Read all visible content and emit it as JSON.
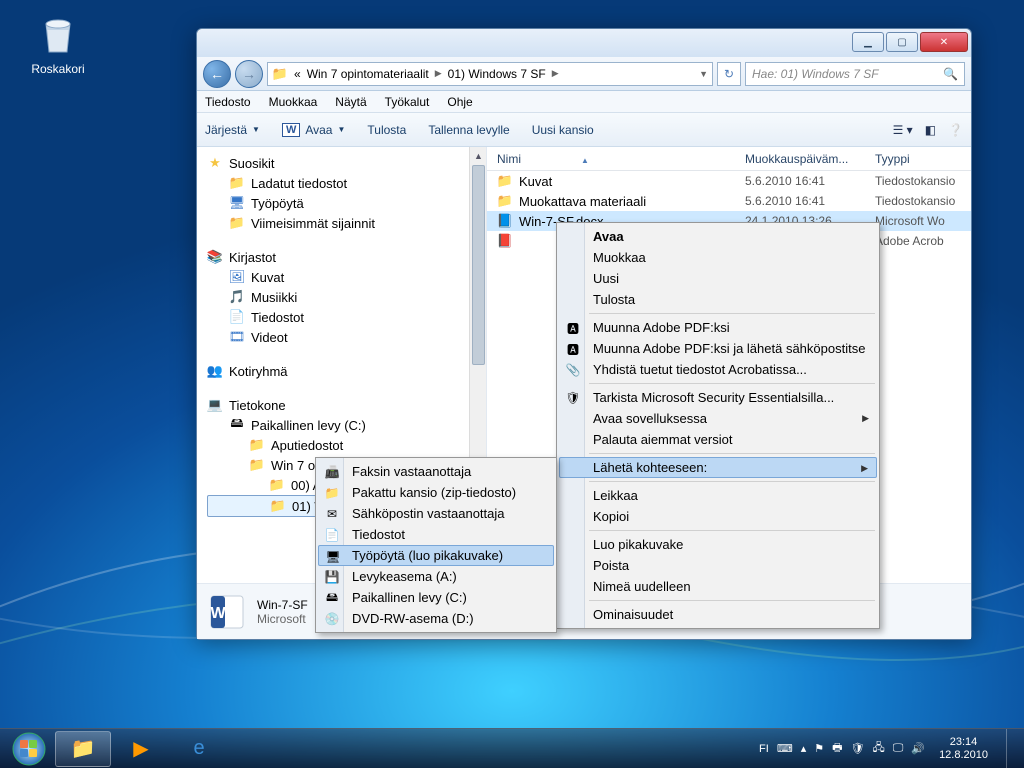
{
  "desktop": {
    "recycle_bin": "Roskakori"
  },
  "window": {
    "controls": {
      "min": "▁",
      "max": "▢",
      "close": "✕"
    },
    "breadcrumb": {
      "prefix": "«",
      "seg1": "Win 7 opintomateriaalit",
      "seg2": "01) Windows 7 SF"
    },
    "search_placeholder": "Hae: 01) Windows 7 SF",
    "menus": [
      "Tiedosto",
      "Muokkaa",
      "Näytä",
      "Työkalut",
      "Ohje"
    ],
    "toolbar": {
      "organize": "Järjestä",
      "open": "Avaa",
      "print": "Tulosta",
      "save": "Tallenna levylle",
      "newfolder": "Uusi kansio"
    }
  },
  "nav": {
    "favorites": "Suosikit",
    "fav_items": [
      "Ladatut tiedostot",
      "Työpöytä",
      "Viimeisimmät sijainnit"
    ],
    "libraries": "Kirjastot",
    "lib_items": [
      "Kuvat",
      "Musiikki",
      "Tiedostot",
      "Videot"
    ],
    "homegroup": "Kotiryhmä",
    "computer": "Tietokone",
    "local": "Paikallinen levy (C:)",
    "aputied": "Aputiedostot",
    "win7mat": "Win 7 opintomateriaalit",
    "f00": "00) Aputiedostot",
    "f01": "01) Windows 7 SF"
  },
  "columns": {
    "name": "Nimi",
    "modified": "Muokkauspäiväm...",
    "type": "Tyyppi"
  },
  "files": [
    {
      "name": "Kuvat",
      "date": "5.6.2010 16:41",
      "type": "Tiedostokansio",
      "icon": "folder"
    },
    {
      "name": "Muokattava materiaali",
      "date": "5.6.2010 16:41",
      "type": "Tiedostokansio",
      "icon": "folder"
    },
    {
      "name": "Win-7-SF.docx",
      "date": "24.1.2010 13:26",
      "type": "Microsoft Wo",
      "icon": "word",
      "sel": true
    },
    {
      "name": "",
      "date": "",
      "type": "Adobe Acrob",
      "icon": "pdf"
    }
  ],
  "details": {
    "title": "Win-7-SF",
    "sub": "Microsoft"
  },
  "ctx_main": [
    {
      "t": "Avaa",
      "bold": true
    },
    {
      "t": "Muokkaa"
    },
    {
      "t": "Uusi"
    },
    {
      "t": "Tulosta"
    },
    {
      "sep": true
    },
    {
      "t": "Muunna Adobe PDF:ksi",
      "ico": "🅰"
    },
    {
      "t": "Muunna Adobe PDF:ksi ja lähetä sähköpostitse",
      "ico": "🅰"
    },
    {
      "t": "Yhdistä tuetut tiedostot Acrobatissa...",
      "ico": "📎"
    },
    {
      "sep": true
    },
    {
      "t": "Tarkista Microsoft Security Essentialsilla...",
      "ico": "🛡"
    },
    {
      "t": "Avaa sovelluksessa",
      "sub": true
    },
    {
      "t": "Palauta aiemmat versiot"
    },
    {
      "sep": true
    },
    {
      "t": "Lähetä kohteeseen:",
      "sub": true,
      "hover": true
    },
    {
      "sep": true
    },
    {
      "t": "Leikkaa"
    },
    {
      "t": "Kopioi"
    },
    {
      "sep": true
    },
    {
      "t": "Luo pikakuvake"
    },
    {
      "t": "Poista"
    },
    {
      "t": "Nimeä uudelleen"
    },
    {
      "sep": true
    },
    {
      "t": "Ominaisuudet"
    }
  ],
  "ctx_sub": [
    {
      "t": "Faksin vastaanottaja",
      "ico": "📠"
    },
    {
      "t": "Pakattu kansio (zip-tiedosto)",
      "ico": "📁"
    },
    {
      "t": "Sähköpostin vastaanottaja",
      "ico": "✉"
    },
    {
      "t": "Tiedostot",
      "ico": "📄"
    },
    {
      "t": "Työpöytä (luo pikakuvake)",
      "ico": "🖥",
      "hover": true
    },
    {
      "t": "Levykeasema (A:)",
      "ico": "💾"
    },
    {
      "t": "Paikallinen levy (C:)",
      "ico": "🖴"
    },
    {
      "t": "DVD-RW-asema (D:)",
      "ico": "💿"
    }
  ],
  "tray": {
    "lang": "FI",
    "time": "23:14",
    "date": "12.8.2010"
  }
}
